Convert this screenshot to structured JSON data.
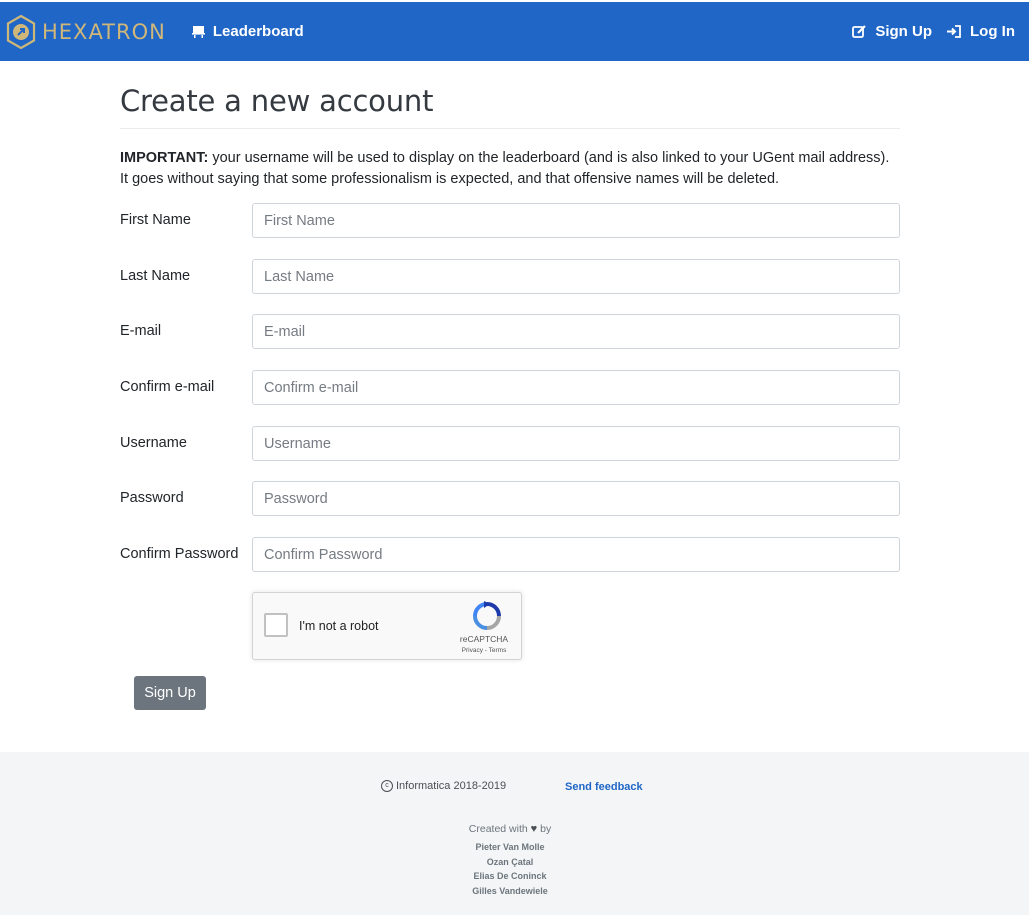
{
  "navbar": {
    "brand": "HEXATRON",
    "leaderboard_label": "Leaderboard",
    "signup_label": "Sign Up",
    "login_label": "Log In",
    "bg_color": "#1f66c7",
    "brand_color": "#cfb77a"
  },
  "page": {
    "title": "Create a new account",
    "notice_strong": "IMPORTANT:",
    "notice_text": " your username will be used to display on the leaderboard (and is also linked to your UGent mail address). It goes without saying that some professionalism is expected, and that offensive names will be deleted."
  },
  "form": {
    "fields": [
      {
        "label": "First Name",
        "placeholder": "First Name",
        "value": ""
      },
      {
        "label": "Last Name",
        "placeholder": "Last Name",
        "value": ""
      },
      {
        "label": "E-mail",
        "placeholder": "E-mail",
        "value": ""
      },
      {
        "label": "Confirm e-mail",
        "placeholder": "Confirm e-mail",
        "value": ""
      },
      {
        "label": "Username",
        "placeholder": "Username",
        "value": ""
      },
      {
        "label": "Password",
        "placeholder": "Password",
        "value": ""
      },
      {
        "label": "Confirm Password",
        "placeholder": "Confirm Password",
        "value": ""
      }
    ],
    "captcha": {
      "label": "I'm not a robot",
      "brand": "reCAPTCHA",
      "links": "Privacy - Terms"
    },
    "submit_label": "Sign Up"
  },
  "footer": {
    "copyright": "Informatica 2018-2019",
    "feedback_label": "Send feedback",
    "created_prefix": "Created with",
    "created_suffix": "by",
    "authors": [
      "Pieter Van Molle",
      "Ozan Çatal",
      "Elias De Coninck",
      "Gilles Vandewiele"
    ]
  }
}
